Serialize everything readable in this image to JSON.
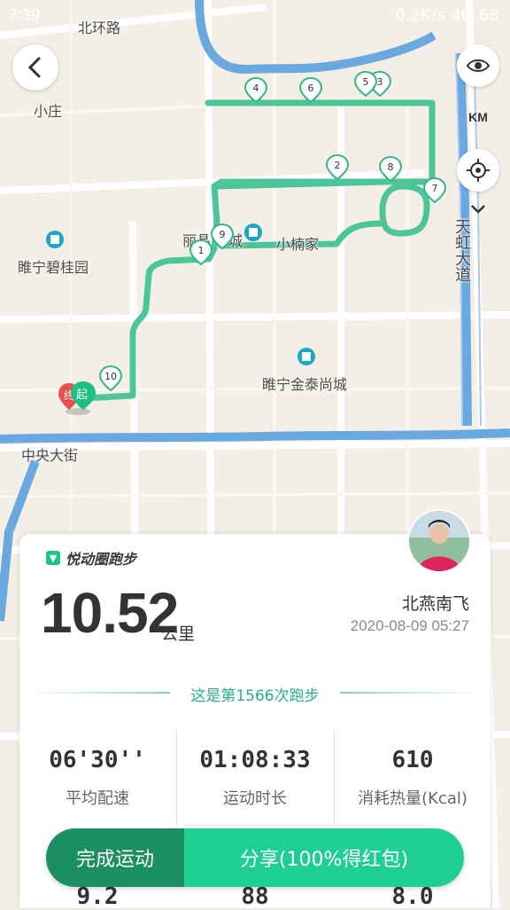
{
  "status_bar": {
    "time": "7:39",
    "speed": "0.2K/s",
    "network": "4G",
    "battery": "68"
  },
  "map": {
    "labels": {
      "road_north": "北环路",
      "xiaozhuang": "小庄",
      "bigui": "睢宁碧桂园",
      "liyuan": "丽晶",
      "liyuan_suffix": "城",
      "xiaonanjia": "小楠家",
      "jintai": "睢宁金泰尚城",
      "zhongyang": "中央大街",
      "tianhong": "天虹大道"
    },
    "start_marker": "起",
    "end_marker": "终",
    "km_markers": [
      "1",
      "2",
      "3",
      "4",
      "5",
      "6",
      "7",
      "8",
      "9",
      "10"
    ],
    "controls": {
      "back_icon": "chevron-left-icon",
      "eye_icon": "eye-icon",
      "km_label": "KM",
      "locate_icon": "crosshair-icon",
      "collapse_icon": "chevron-down-icon"
    },
    "route_color": "#4cc59a"
  },
  "summary": {
    "brand": "悦动圈跑步",
    "distance": "10.52",
    "distance_unit": "公里",
    "user_name": "北燕南飞",
    "datetime": "2020-08-09 05:27",
    "run_count_text": "这是第1566次跑步",
    "stats": [
      {
        "value": "06'30''",
        "label": "平均配速"
      },
      {
        "value": "01:08:33",
        "label": "运动时长"
      },
      {
        "value": "610",
        "label": "消耗热量(Kcal)"
      }
    ],
    "partial_stats": [
      "9.2",
      "88",
      "8.0"
    ]
  },
  "actions": {
    "finish": "完成运动",
    "share": "分享(100%得红包)"
  },
  "colors": {
    "accent": "#1fcf91",
    "accent_dark": "#1b8f63",
    "water": "#5b9bd5"
  }
}
